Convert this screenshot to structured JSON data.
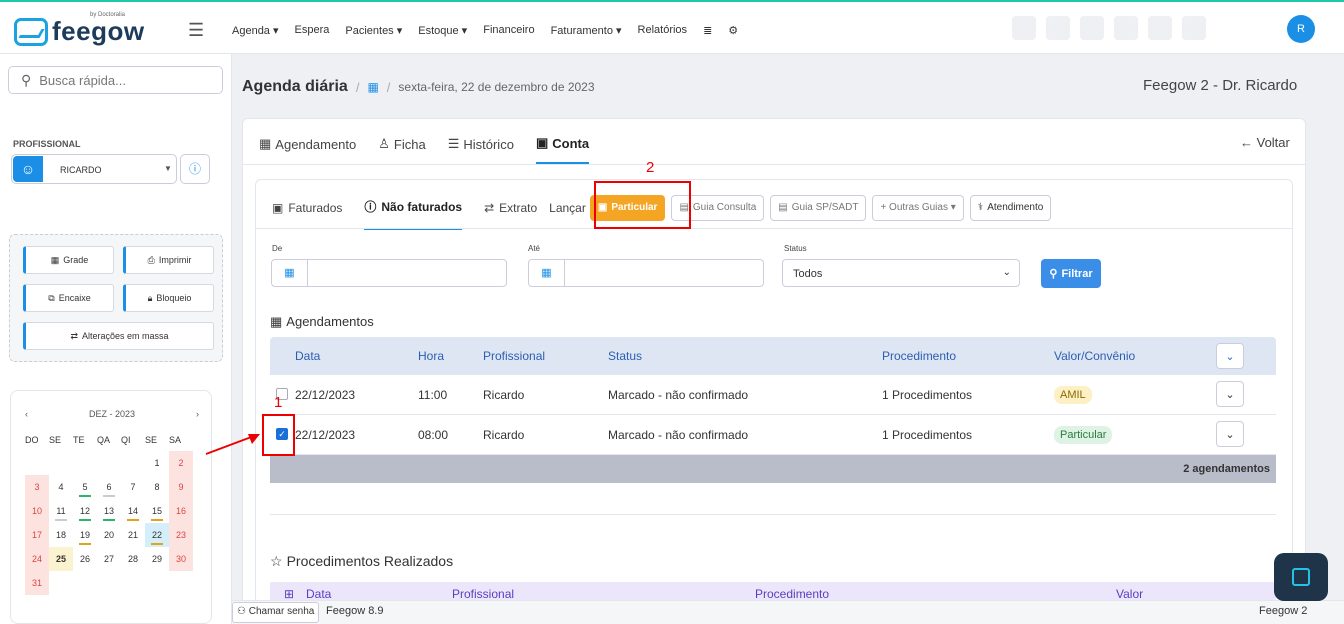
{
  "header": {
    "logo_by": "by Doctoralia",
    "logo_text": "feegow",
    "nav": [
      "Agenda ▾",
      "Espera",
      "Pacientes ▾",
      "Estoque ▾",
      "Financeiro",
      "Faturamento ▾",
      "Relatórios"
    ],
    "avatar": "R"
  },
  "sidebar": {
    "search_placeholder": "Busca rápida...",
    "prof_label": "PROFISSIONAL",
    "prof_name": "RICARDO",
    "buttons": {
      "grade": "Grade",
      "imprimir": "Imprimir",
      "encaixe": "Encaixe",
      "bloqueio": "Bloqueio",
      "massa": "Alterações em massa"
    },
    "calendar": {
      "month": "DEZ - 2023",
      "weekdays": [
        "DO",
        "SE",
        "TE",
        "QA",
        "QI",
        "SE",
        "SA"
      ],
      "days": [
        [
          "",
          "",
          "",
          "",
          "",
          "1",
          "2"
        ],
        [
          "3",
          "4",
          "5",
          "6",
          "7",
          "8",
          "9"
        ],
        [
          "10",
          "11",
          "12",
          "13",
          "14",
          "15",
          "16"
        ],
        [
          "17",
          "18",
          "19",
          "20",
          "21",
          "22",
          "23"
        ],
        [
          "24",
          "25",
          "26",
          "27",
          "28",
          "29",
          "30"
        ],
        [
          "31",
          "",
          "",
          "",
          "",
          "",
          ""
        ]
      ]
    }
  },
  "breadcrumb": {
    "title": "Agenda diária",
    "date": "sexta-feira, 22 de dezembro de 2023",
    "context": "Feegow 2 - Dr. Ricardo"
  },
  "tabs": [
    "Agendamento",
    "Ficha",
    "Histórico",
    "Conta"
  ],
  "voltar": "← Voltar",
  "subtabs": {
    "faturados": "Faturados",
    "nao_faturados": "Não faturados",
    "extrato": "Extrato",
    "lancar": "Lançar"
  },
  "guides": {
    "particular": "Particular",
    "consulta": "Guia Consulta",
    "spsadt": "Guia SP/SADT",
    "outras": "+ Outras Guias ▾",
    "atendimento": "Atendimento"
  },
  "filters": {
    "de": "De",
    "ate": "Até",
    "status_label": "Status",
    "status_value": "Todos",
    "filtrar": "Filtrar"
  },
  "agendamentos": {
    "title": "Agendamentos",
    "columns": [
      "Data",
      "Hora",
      "Profissional",
      "Status",
      "Procedimento",
      "Valor/Convênio"
    ],
    "rows": [
      {
        "data": "22/12/2023",
        "hora": "11:00",
        "prof": "Ricardo",
        "status": "Marcado - não confirmado",
        "proc": "1 Procedimentos",
        "valor": "AMIL"
      },
      {
        "data": "22/12/2023",
        "hora": "08:00",
        "prof": "Ricardo",
        "status": "Marcado - não confirmado",
        "proc": "1 Procedimentos",
        "valor": "Particular"
      }
    ],
    "footer": "2 agendamentos"
  },
  "procedimentos": {
    "title": "Procedimentos Realizados",
    "columns": [
      "Data",
      "Profissional",
      "Procedimento",
      "Valor"
    ]
  },
  "footer": {
    "chamar": "Chamar senha",
    "version": "Feegow 8.9",
    "right": "Feegow 2"
  },
  "annotations": {
    "one": "1",
    "two": "2"
  },
  "colors": {
    "accent": "#1b8fe6",
    "orange": "#f5a524",
    "annotation": "#e00000"
  }
}
